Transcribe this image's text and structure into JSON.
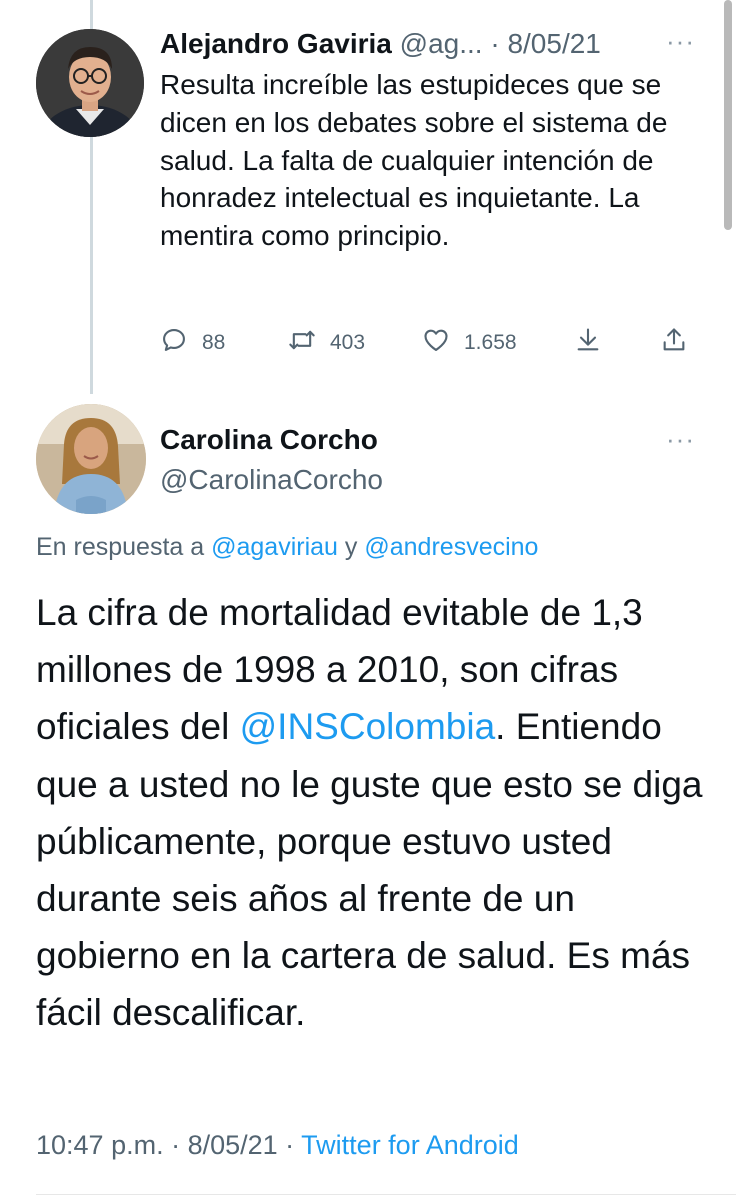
{
  "tweet1": {
    "author_name": "Alejandro Gaviria",
    "handle": "@ag...",
    "date": "· 8/05/21",
    "more": "···",
    "text": "Resulta increíble las estupideces que se dicen en los debates sobre el sistema de salud. La falta de cualquier intención de honradez intelectual es inquietante. La mentira como principio.",
    "replies": "88",
    "retweets": "403",
    "likes": "1.658"
  },
  "tweet2": {
    "author_name": "Carolina Corcho",
    "handle": "@CarolinaCorcho",
    "more": "···",
    "reply_prefix": "En respuesta a ",
    "reply_mention1": "@agaviriau",
    "reply_connector": " y ",
    "reply_mention2": "@andresvecino",
    "text_part1": "La cifra de mortalidad evitable de 1,3 millones de 1998 a 2010, son cifras oficiales del ",
    "text_mention": "@INSColombia",
    "text_part2": ". Entiendo que a usted no le guste que esto se diga públicamente, porque estuvo usted durante seis años al frente de un gobierno en la cartera de salud. Es más fácil descalificar.",
    "time": "10:47 p.m.",
    "date": " · 8/05/21 · ",
    "source": "Twitter for Android"
  },
  "icons": [
    "reply-icon",
    "retweet-icon",
    "like-icon",
    "bookmark-icon",
    "share-icon"
  ],
  "colors": {
    "link": "#1d9bf0",
    "muted": "#536471",
    "text": "#0f1419",
    "thread_line": "#cfd9de"
  }
}
